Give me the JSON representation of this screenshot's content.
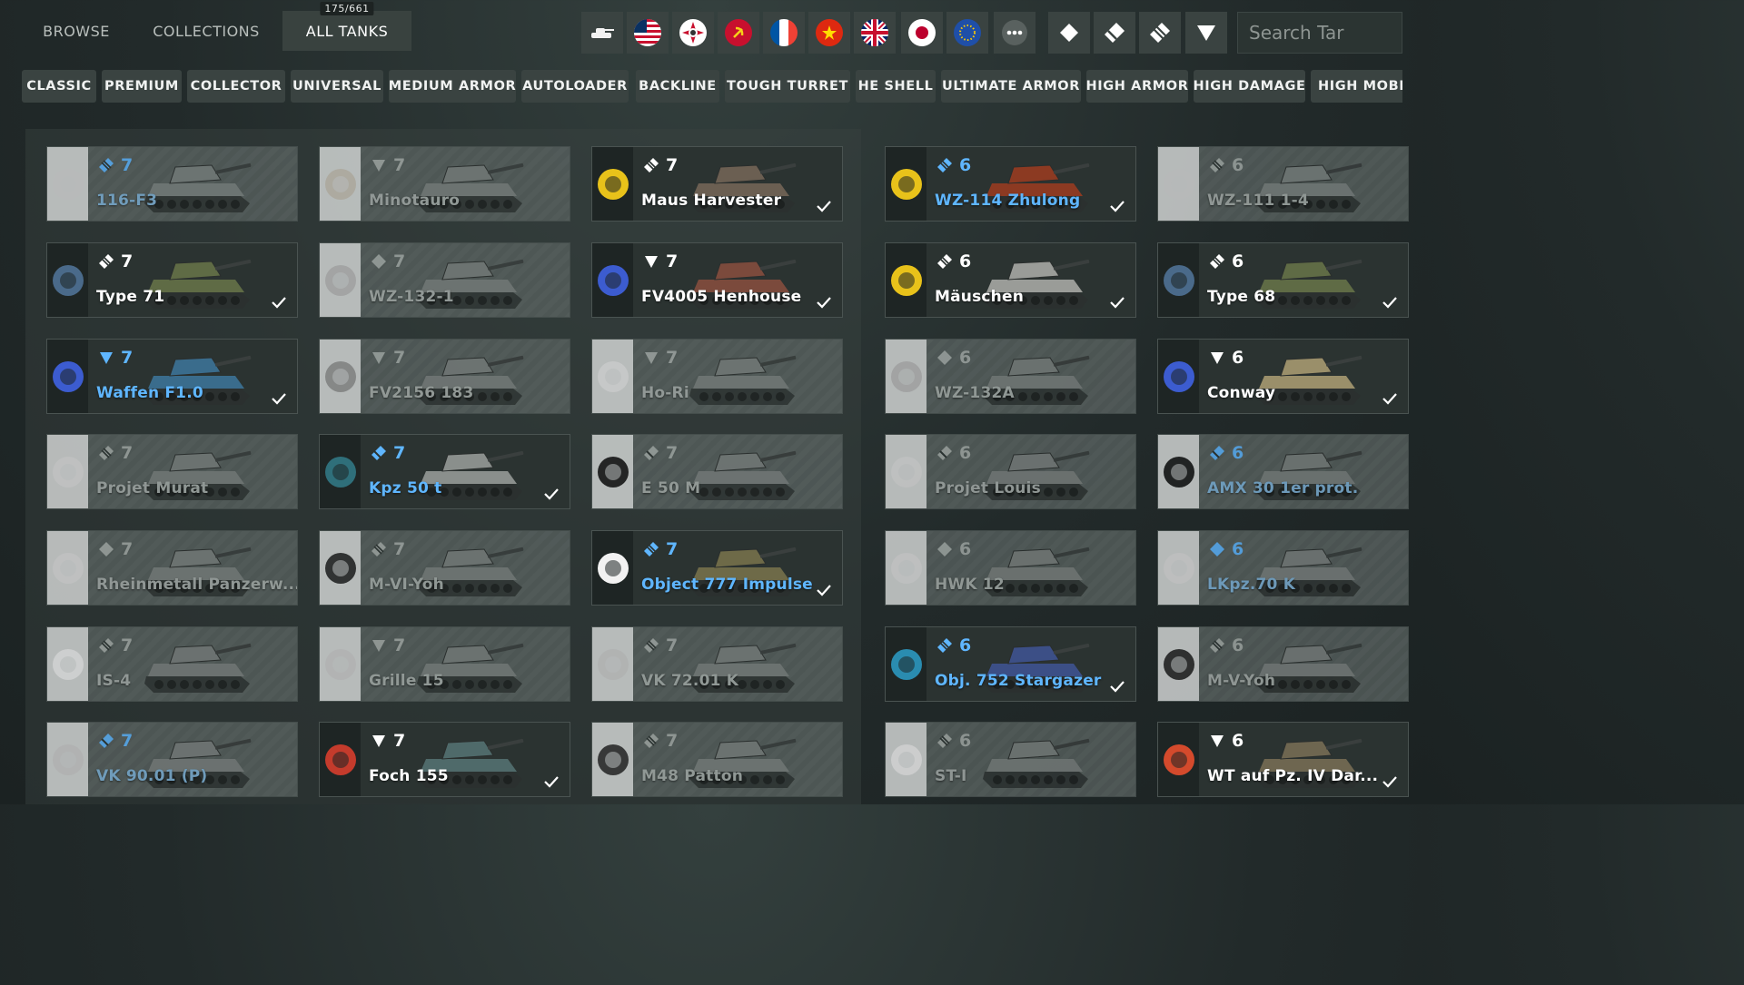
{
  "nav": {
    "tabs": [
      {
        "label": "BROWSE"
      },
      {
        "label": "COLLECTIONS"
      },
      {
        "label": "ALL TANKS",
        "badge": "175/661",
        "active": true
      }
    ]
  },
  "nations": [
    "tank-all-icon",
    "usa-flag-icon",
    "germany-flag-icon",
    "ussr-flag-icon",
    "france-flag-icon",
    "china-flag-icon",
    "uk-flag-icon",
    "japan-flag-icon",
    "europe-flag-icon",
    "more-nations-icon"
  ],
  "classes": [
    "light-tank-icon",
    "medium-tank-icon",
    "heavy-tank-icon",
    "tank-destroyer-icon"
  ],
  "search": {
    "placeholder": "Search Tar"
  },
  "chips": [
    {
      "label": "CLASSIC"
    },
    {
      "label": "PREMIUM"
    },
    {
      "label": "COLLECTOR"
    },
    {
      "label": "UNIVERSAL"
    },
    {
      "label": "MEDIUM ARMOR"
    },
    {
      "label": "AUTOLOADER"
    },
    {
      "label": "BACKLINE"
    },
    {
      "label": "TOUGH TURRET"
    },
    {
      "label": "HE SHELL"
    },
    {
      "label": "ULTIMATE ARMOR"
    },
    {
      "label": "HIGH ARMOR"
    },
    {
      "label": "HIGH DAMAGE"
    },
    {
      "label": "HIGH MOBILITY"
    }
  ],
  "colors": {
    "premium": "#5fb6ff",
    "owned_bg": "#2b3331",
    "unowned_bg": "#4c5553"
  },
  "cards": [
    {
      "name": "116-F3",
      "tier": "7",
      "cls": "heavy",
      "state": "locked",
      "premium": true,
      "emblem": "dragon",
      "camo": "#7b8280"
    },
    {
      "name": "Minotauro",
      "tier": "7",
      "cls": "td",
      "state": "locked",
      "premium": false,
      "emblem": "skull",
      "camo": "#7a807e"
    },
    {
      "name": "Maus Harvester",
      "tier": "7",
      "cls": "heavy",
      "state": "owned",
      "premium": false,
      "emblem": "yellow-beast",
      "camo": "#6b5f52"
    },
    {
      "name": "WZ-114 Zhulong",
      "tier": "6",
      "cls": "heavy",
      "state": "owned",
      "premium": true,
      "emblem": "yellow-dragon",
      "camo": "#8c3a22"
    },
    {
      "name": "WZ-111 1-4",
      "tier": "6",
      "cls": "heavy",
      "state": "locked",
      "premium": false,
      "emblem": "dragon",
      "camo": "#7b8280"
    },
    {
      "name": "Type 71",
      "tier": "7",
      "cls": "heavy",
      "state": "owned",
      "premium": false,
      "emblem": "wolf",
      "camo": "#5f6b45"
    },
    {
      "name": "WZ-132-1",
      "tier": "7",
      "cls": "light",
      "state": "locked",
      "premium": false,
      "emblem": "raccoon",
      "camo": "#7a807e"
    },
    {
      "name": "FV4005 Henhouse",
      "tier": "7",
      "cls": "td",
      "state": "owned",
      "premium": false,
      "emblem": "cyber",
      "camo": "#7b4a3c"
    },
    {
      "name": "Mäuschen",
      "tier": "6",
      "cls": "heavy",
      "state": "owned",
      "premium": false,
      "emblem": "yellow-beast",
      "camo": "#9a9c98"
    },
    {
      "name": "Type 68",
      "tier": "6",
      "cls": "heavy",
      "state": "owned",
      "premium": false,
      "emblem": "wolf",
      "camo": "#5f6b45"
    },
    {
      "name": "Waffen F1.0",
      "tier": "7",
      "cls": "td",
      "state": "owned",
      "premium": true,
      "emblem": "cyber",
      "camo": "#3a6c8c"
    },
    {
      "name": "FV2156 183",
      "tier": "7",
      "cls": "td",
      "state": "locked",
      "premium": false,
      "emblem": "shark",
      "camo": "#7a807e"
    },
    {
      "name": "Ho-Ri",
      "tier": "7",
      "cls": "td",
      "state": "locked",
      "premium": false,
      "emblem": "sword",
      "camo": "#7a807e"
    },
    {
      "name": "WZ-132A",
      "tier": "6",
      "cls": "light",
      "state": "locked",
      "premium": false,
      "emblem": "raccoon",
      "camo": "#7a807e"
    },
    {
      "name": "Conway",
      "tier": "6",
      "cls": "td",
      "state": "owned",
      "premium": false,
      "emblem": "cyber",
      "camo": "#9a8f6a"
    },
    {
      "name": "Projet Murat",
      "tier": "7",
      "cls": "heavy",
      "state": "locked",
      "premium": false,
      "emblem": "bird",
      "camo": "#7a807e"
    },
    {
      "name": "Kpz 50 t",
      "tier": "7",
      "cls": "medium",
      "state": "owned",
      "premium": true,
      "emblem": "dragon-blue",
      "camo": "#8a8f8c"
    },
    {
      "name": "E 50 M",
      "tier": "7",
      "cls": "medium",
      "state": "locked",
      "premium": false,
      "emblem": "panther",
      "camo": "#7a807e"
    },
    {
      "name": "Projet Louis",
      "tier": "6",
      "cls": "medium",
      "state": "locked",
      "premium": false,
      "emblem": "bird",
      "camo": "#7a807e"
    },
    {
      "name": "AMX 30 1er prot.",
      "tier": "6",
      "cls": "medium",
      "state": "locked",
      "premium": true,
      "emblem": "panther",
      "camo": "#7a807e"
    },
    {
      "name": "Rheinmetall Panzerw...",
      "tier": "7",
      "cls": "light",
      "state": "locked",
      "premium": false,
      "emblem": "bird",
      "camo": "#7a807e"
    },
    {
      "name": "M-VI-Yoh",
      "tier": "7",
      "cls": "heavy",
      "state": "locked",
      "premium": false,
      "emblem": "mask",
      "camo": "#7a807e"
    },
    {
      "name": "Object 777 Impulse",
      "tier": "7",
      "cls": "heavy",
      "state": "owned",
      "premium": true,
      "emblem": "burst",
      "camo": "#6e6a48"
    },
    {
      "name": "HWK 12",
      "tier": "6",
      "cls": "light",
      "state": "locked",
      "premium": false,
      "emblem": "bird",
      "camo": "#7a807e"
    },
    {
      "name": "LKpz.70 K",
      "tier": "6",
      "cls": "light",
      "state": "locked",
      "premium": true,
      "emblem": "bird",
      "camo": "#7a807e"
    },
    {
      "name": "IS-4",
      "tier": "7",
      "cls": "heavy",
      "state": "locked",
      "premium": false,
      "emblem": "burst",
      "camo": "#7a807e"
    },
    {
      "name": "Grille 15",
      "tier": "7",
      "cls": "td",
      "state": "locked",
      "premium": false,
      "emblem": "wolf-white",
      "camo": "#7a807e"
    },
    {
      "name": "VK 72.01 K",
      "tier": "7",
      "cls": "heavy",
      "state": "locked",
      "premium": false,
      "emblem": "knight",
      "camo": "#7a807e"
    },
    {
      "name": "Obj. 752 Stargazer",
      "tier": "6",
      "cls": "heavy",
      "state": "owned",
      "premium": true,
      "emblem": "robot",
      "camo": "#3c4f86"
    },
    {
      "name": "M-V-Yoh",
      "tier": "6",
      "cls": "heavy",
      "state": "locked",
      "premium": false,
      "emblem": "mask",
      "camo": "#7a807e"
    },
    {
      "name": "VK 90.01 (P)",
      "tier": "7",
      "cls": "medium",
      "state": "locked",
      "premium": true,
      "emblem": "knight",
      "camo": "#7a807e"
    },
    {
      "name": "Foch 155",
      "tier": "7",
      "cls": "td",
      "state": "owned",
      "premium": false,
      "emblem": "red-triangle",
      "camo": "#4f6a6a"
    },
    {
      "name": "M48 Patton",
      "tier": "7",
      "cls": "heavy",
      "state": "locked",
      "premium": false,
      "emblem": "soldier",
      "camo": "#7a807e"
    },
    {
      "name": "ST-I",
      "tier": "6",
      "cls": "heavy",
      "state": "locked",
      "premium": false,
      "emblem": "burst",
      "camo": "#7a807e"
    },
    {
      "name": "WT auf Pz. IV Dar...",
      "tier": "6",
      "cls": "td",
      "state": "owned",
      "premium": false,
      "emblem": "fox",
      "camo": "#6e6650"
    }
  ]
}
